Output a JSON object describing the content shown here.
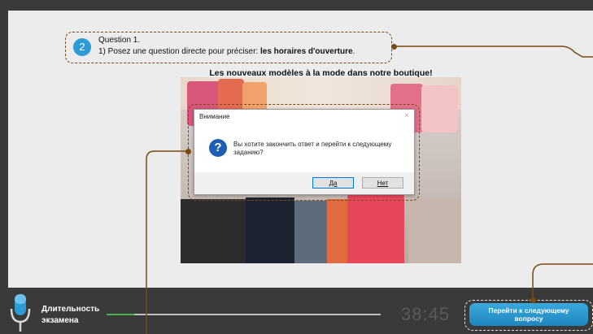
{
  "question": {
    "number": "2",
    "title": "Question 1.",
    "text_prefix": "1) Posez une question directe pour préciser: ",
    "text_bold": "les horaires d'ouverture",
    "text_suffix": "."
  },
  "image": {
    "caption": "Les nouveaux modèles à la mode dans notre boutique!"
  },
  "dialog": {
    "title": "Внимание",
    "close": "×",
    "icon": "?",
    "message": "Вы хотите закончить ответ и перейти к следующему заданию?",
    "yes_label": "Да",
    "no_label": "Нет"
  },
  "footer": {
    "duration_line1": "Длительность",
    "duration_line2": "экзамена",
    "progress": 0.1,
    "timer": "38:45",
    "next_button_line1": "Перейти к следующему",
    "next_button_line2": "вопросу"
  },
  "colors": {
    "accent": "#2e9bd5",
    "annotation": "#7b4a12",
    "progress": "#4caf50"
  }
}
